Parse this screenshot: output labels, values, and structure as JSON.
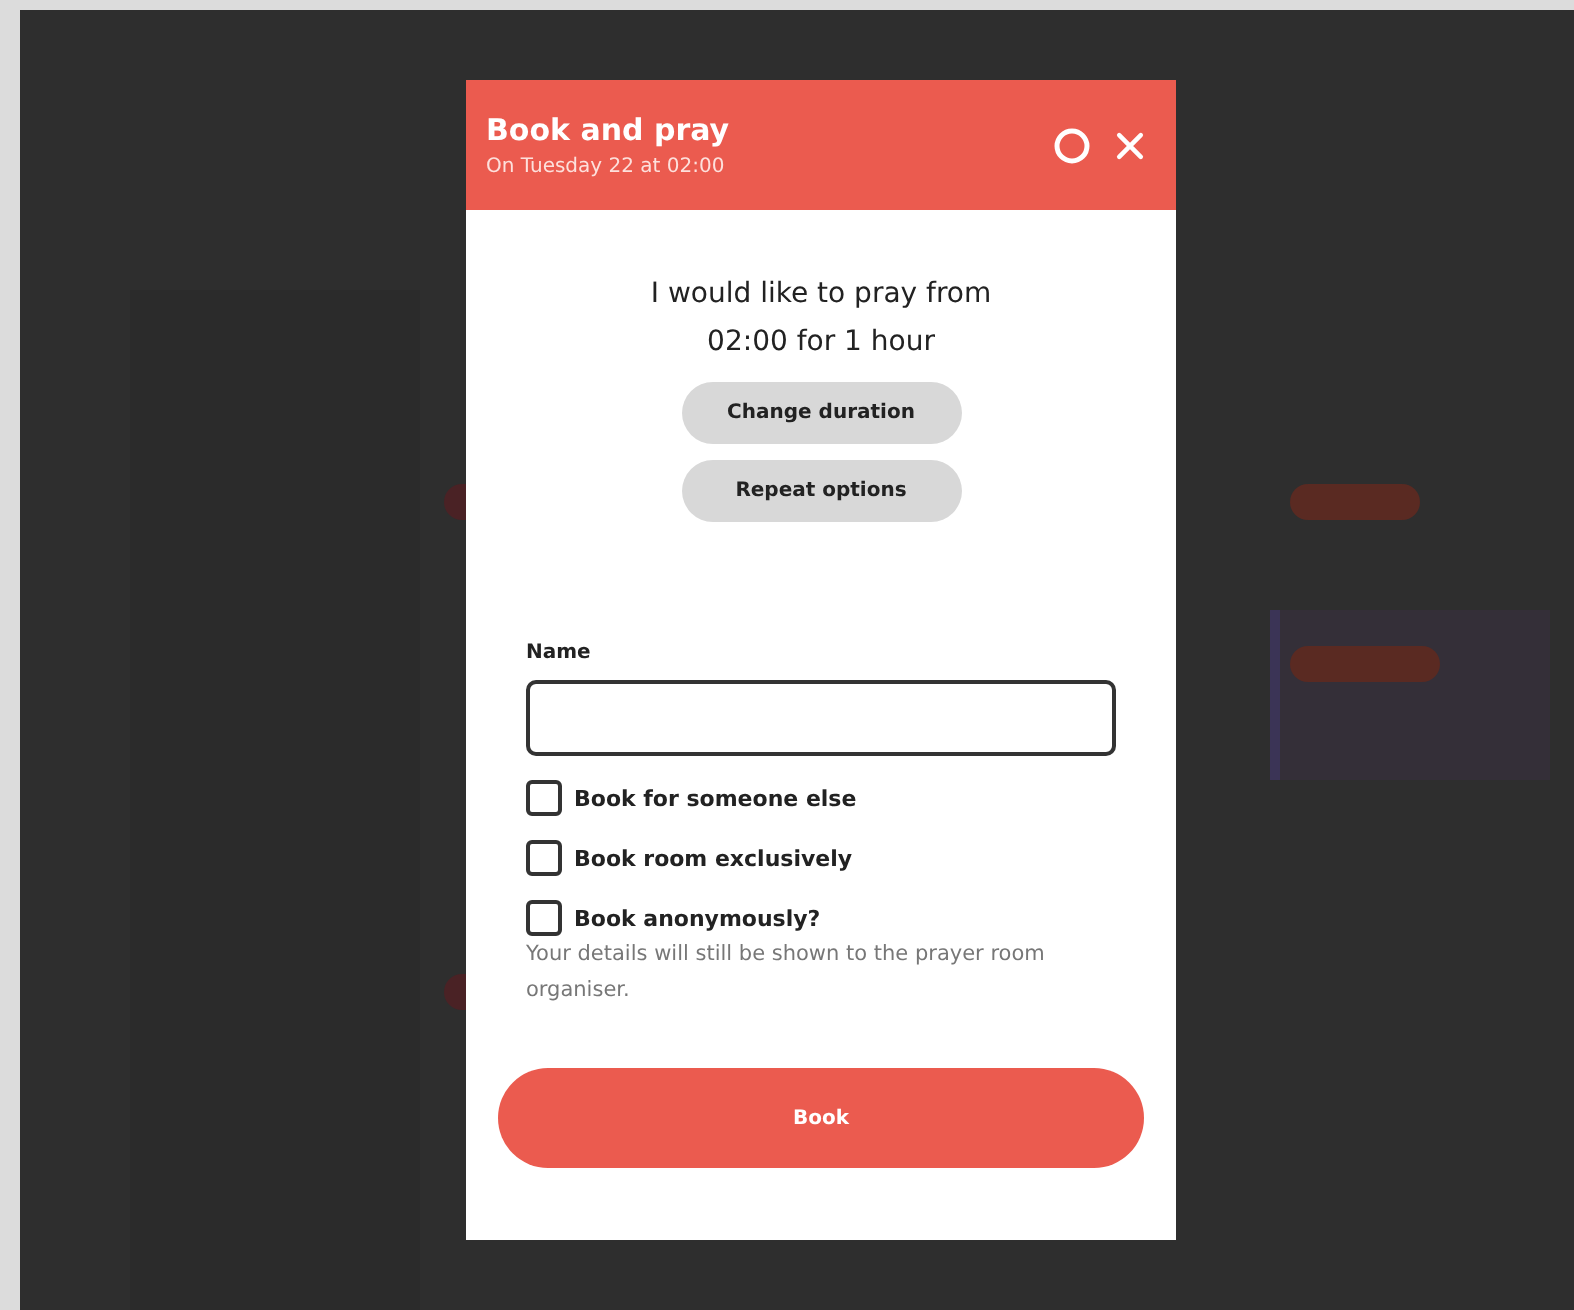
{
  "dialog": {
    "title": "Book and pray",
    "subtitle": "On Tuesday 22 at 02:00",
    "intro": "I would like to pray from 02:00 for 1 hour",
    "option_buttons": [
      "Change duration",
      "Repeat options"
    ],
    "name_field": {
      "label": "Name"
    },
    "checkboxes": [
      {
        "label": "Book for someone else",
        "checked": false
      },
      {
        "label": "Book room exclusively",
        "checked": false
      },
      {
        "label": "Book anonymously?",
        "checked": false
      }
    ],
    "note": "Your details will still be shown to the prayer room organiser.",
    "submit": "Book"
  }
}
